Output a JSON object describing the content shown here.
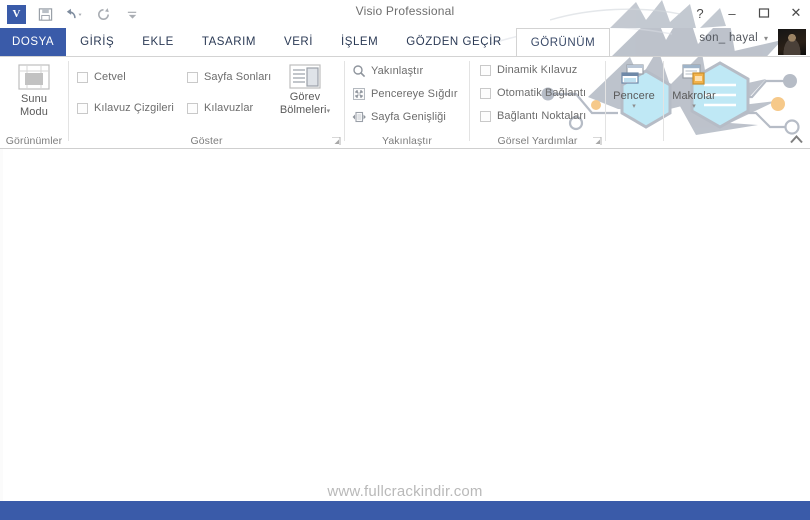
{
  "window": {
    "title": "Visio Professional",
    "quick_access": [
      {
        "name": "visio-logo",
        "glyph": "V"
      },
      {
        "name": "save-icon",
        "label": "Kaydet"
      },
      {
        "name": "undo-icon",
        "label": "Geri Al"
      },
      {
        "name": "redo-icon",
        "label": "Yinele"
      },
      {
        "name": "customize-qat-icon",
        "label": "Özelleştir"
      }
    ],
    "controls": [
      {
        "name": "help-button",
        "glyph": "?"
      },
      {
        "name": "minimize-button",
        "glyph": "–"
      },
      {
        "name": "restore-button",
        "glyph": "❐"
      },
      {
        "name": "close-button",
        "glyph": "✕"
      }
    ]
  },
  "account": {
    "name": "son_ hayal",
    "caret": "▾"
  },
  "tabs": [
    {
      "label": "DOSYA",
      "state": "file"
    },
    {
      "label": "GİRİŞ",
      "state": "normal"
    },
    {
      "label": "EKLE",
      "state": "normal"
    },
    {
      "label": "TASARIM",
      "state": "normal"
    },
    {
      "label": "VERİ",
      "state": "normal"
    },
    {
      "label": "İŞLEM",
      "state": "normal"
    },
    {
      "label": "GÖZDEN GEÇİR",
      "state": "normal"
    },
    {
      "label": "GÖRÜNÜM",
      "state": "active"
    }
  ],
  "ribbon": {
    "collapse_label": "Şeridi Daralt",
    "groups": {
      "views": {
        "label": "Görünümler",
        "presentation_mode": {
          "line1": "Sunu",
          "line2": "Modu"
        }
      },
      "show": {
        "label": "Göster",
        "checkboxes": [
          {
            "label": "Cetvel",
            "checked": false
          },
          {
            "label": "Kılavuz Çizgileri",
            "checked": false
          },
          {
            "label": "Sayfa Sonları",
            "checked": false
          },
          {
            "label": "Kılavuzlar",
            "checked": false
          }
        ],
        "task_panes": {
          "line1": "Görev",
          "line2": "Bölmeleri",
          "caret": "▾"
        },
        "launcher": "↘"
      },
      "zoom": {
        "label": "Yakınlaştır",
        "items": [
          {
            "label": "Yakınlaştır",
            "icon": "magnifier-icon"
          },
          {
            "label": "Pencereye Sığdır",
            "icon": "fit-window-icon"
          },
          {
            "label": "Sayfa Genişliği",
            "icon": "page-width-icon"
          }
        ]
      },
      "visual_aids": {
        "label": "Görsel Yardımlar",
        "checkboxes": [
          {
            "label": "Dinamik Kılavuz",
            "checked": false
          },
          {
            "label": "Otomatik Bağlantı",
            "checked": false
          },
          {
            "label": "Bağlantı Noktaları",
            "checked": false
          }
        ],
        "launcher": "↘"
      },
      "window": {
        "label": "Pencere",
        "button": {
          "label": "Pencere",
          "caret": "▾"
        }
      },
      "macros": {
        "label": "Makrolar",
        "button": {
          "label": "Makrolar",
          "caret": "▾"
        }
      }
    }
  },
  "canvas": {
    "watermark": "www.fullcrackindir.com"
  },
  "colors": {
    "accent": "#3a5ba9",
    "ribbon_text": "#6c6c6c",
    "tab_text": "#2b3a55",
    "deco_gray": "#b6bcc6",
    "deco_cyan": "#bfe8f5",
    "deco_orange": "#f6c98a"
  }
}
